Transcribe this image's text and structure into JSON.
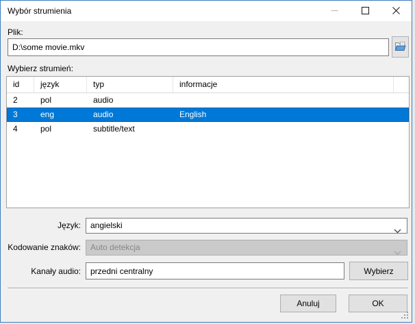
{
  "window": {
    "title": "Wybór strumienia"
  },
  "file_section": {
    "label": "Plik:",
    "path_value": "D:\\some movie.mkv"
  },
  "stream_section": {
    "label": "Wybierz strumień:",
    "columns": [
      "id",
      "język",
      "typ",
      "informacje"
    ],
    "rows": [
      {
        "id": "2",
        "jezyk": "pol",
        "typ": "audio",
        "info": ""
      },
      {
        "id": "3",
        "jezyk": "eng",
        "typ": "audio",
        "info": "English"
      },
      {
        "id": "4",
        "jezyk": "pol",
        "typ": "subtitle/text",
        "info": ""
      }
    ],
    "selected_row_id": "3"
  },
  "form": {
    "language_label": "Język:",
    "language_value": "angielski",
    "encoding_label": "Kodowanie znaków:",
    "encoding_value": "Auto detekcja",
    "encoding_enabled": false,
    "channels_label": "Kanały audio:",
    "channels_value": "przedni centralny",
    "channels_button_label": "Wybierz"
  },
  "footer": {
    "cancel_label": "Anuluj",
    "ok_label": "OK"
  },
  "icons": {
    "browse": "open-folder-icon",
    "dropdown": "chevron-down-icon",
    "minimize": "minimize-icon",
    "maximize": "maximize-icon",
    "close": "close-icon",
    "resize": "resize-grip-icon"
  },
  "colors": {
    "selection_blue": "#0078d7",
    "window_border_blue": "#3a7dbf",
    "dialog_bg": "#f0f0f0",
    "titlebar_bg": "#ffffff",
    "disabled_field_bg": "#cacaca"
  }
}
